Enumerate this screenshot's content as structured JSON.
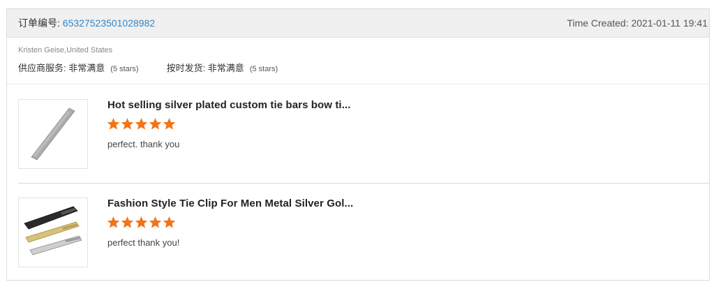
{
  "order": {
    "number_label": "订单编号:",
    "number": "65327523501028982",
    "time_created": "Time Created: 2021-01-11 19:41"
  },
  "buyer": {
    "name_country": "Kristen Geise,United States",
    "ratings": [
      {
        "label": "供应商服务: 非常满意",
        "stars": "(5 stars)"
      },
      {
        "label": "按时发货: 非常满意",
        "stars": "(5 stars)"
      }
    ]
  },
  "products": [
    {
      "title": "Hot selling silver plated custom tie bars bow ti...",
      "rating": 5,
      "comment": "perfect. thank you",
      "image_icon": "tie-bar-product-image"
    },
    {
      "title": "Fashion Style Tie Clip For Men Metal Silver Gol...",
      "rating": 5,
      "comment": "perfect thank you!",
      "image_icon": "tie-clips-product-image"
    }
  ],
  "colors": {
    "link": "#2f86c8",
    "star": "#f07419",
    "header_bg": "#f0f0f0"
  }
}
